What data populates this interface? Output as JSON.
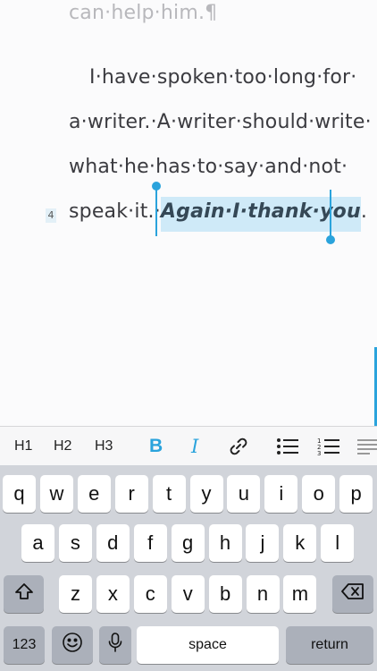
{
  "editor": {
    "previous_line": "can·help·him.¶",
    "lines": [
      "I·have·spoken·too·long·for·",
      "a·writer.·A·writer·should·write·",
      "what·he·has·to·say·and·not·"
    ],
    "last_line_prefix": "speak·it.·",
    "selected_text": "Again·I·thank·you",
    "last_line_suffix": ".",
    "line_number": "4"
  },
  "toolbar": {
    "h1": "H1",
    "h2": "H2",
    "h3": "H3",
    "bold": "B",
    "italic": "I",
    "link_icon": "link-icon",
    "bullet_list_icon": "bullet-list-icon",
    "numbered_list_icon": "numbered-list-icon",
    "align_icon": "align-icon"
  },
  "keyboard": {
    "row1": [
      "q",
      "w",
      "e",
      "r",
      "t",
      "y",
      "u",
      "i",
      "o",
      "p"
    ],
    "row2": [
      "a",
      "s",
      "d",
      "f",
      "g",
      "h",
      "j",
      "k",
      "l"
    ],
    "row3": [
      "z",
      "x",
      "c",
      "v",
      "b",
      "n",
      "m"
    ],
    "numbers_label": "123",
    "space_label": "space",
    "return_label": "return",
    "shift_icon": "shift-icon",
    "delete_icon": "delete-icon",
    "emoji_icon": "emoji-icon",
    "mic_icon": "microphone-icon"
  },
  "colors": {
    "accent": "#2aa3dc",
    "selection": "#cfeaf8"
  }
}
